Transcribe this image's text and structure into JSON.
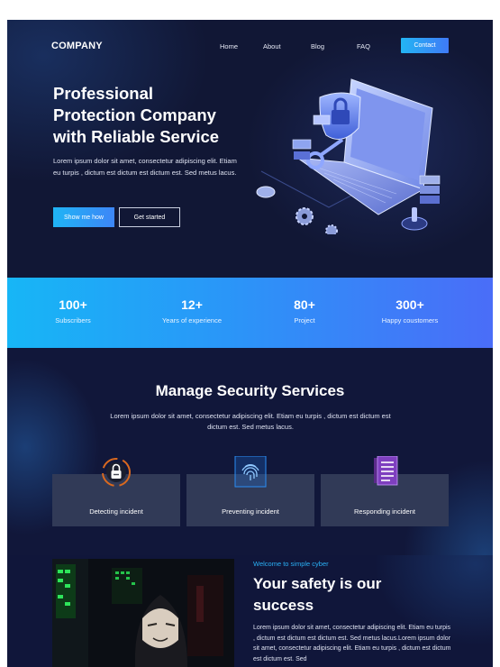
{
  "nav": {
    "logo": "COMPANY",
    "links": [
      "Home",
      "About",
      "Blog",
      "FAQ"
    ],
    "contact_label": "Contact"
  },
  "hero": {
    "title_lines": [
      "Professional",
      "Protection Company",
      "with Reliable Service"
    ],
    "description": "Lorem ipsum dolor sit amet, consectetur adipiscing elit. Etiam eu turpis , dictum est dictum est dictum est. Sed metus lacus.",
    "primary_button": "Show me how",
    "secondary_button": "Get started",
    "illustration_icon": "laptop-security-icon"
  },
  "stats": [
    {
      "value": "100+",
      "label": "Subscribers"
    },
    {
      "value": "12+",
      "label": "Years of experience"
    },
    {
      "value": "80+",
      "label": "Project"
    },
    {
      "value": "300+",
      "label": "Happy coustomers"
    }
  ],
  "services": {
    "title": "Manage Security Services",
    "description": "Lorem ipsum dolor sit amet, consectetur adipiscing elit. Etiam eu turpis , dictum est dictum est dictum est. Sed metus lacus.",
    "cards": [
      {
        "label": "Detecting incident",
        "icon": "lock-icon"
      },
      {
        "label": "Preventing incident",
        "icon": "fingerprint-icon"
      },
      {
        "label": "Responding  incident",
        "icon": "document-icon"
      }
    ]
  },
  "about": {
    "eyebrow": "Welcome to simple cyber",
    "title_lines": [
      "Your safety is our",
      "success"
    ],
    "text": "Lorem ipsum dolor sit amet, consectetur adipiscing elit. Etiam eu turpis , dictum est dictum est dictum est. Sed metus lacus.Lorem ipsum dolor sit amet, consectetur adipiscing elit. Etiam eu turpis , dictum est dictum est dictum est. Sed"
  },
  "colors": {
    "background": "#0f1535",
    "accent_cyan": "#1fb4f5",
    "accent_blue": "#4a6df8",
    "card": "#313a57"
  }
}
